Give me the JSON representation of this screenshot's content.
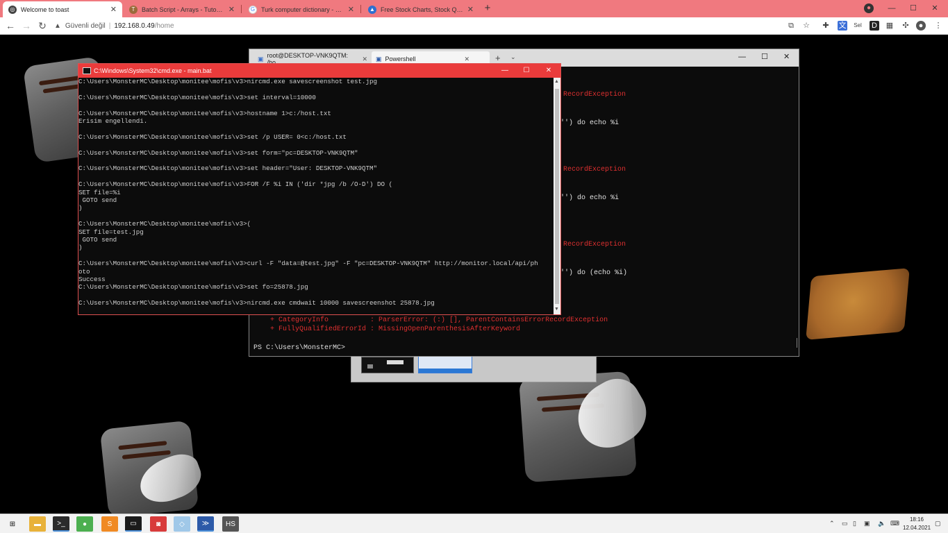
{
  "browser": {
    "tabs": [
      {
        "title": "Welcome to toast",
        "favicon": "globe-icon",
        "color": "#444444"
      },
      {
        "title": "Batch Script - Arrays - Tutorialsp",
        "favicon": "tutorialspoint-icon",
        "color": "#9a6a3a"
      },
      {
        "title": "Turk computer dictionary - Goo",
        "favicon": "google-icon",
        "color": "#4285f4"
      },
      {
        "title": "Free Stock Charts, Stock Quotes",
        "favicon": "chart-icon",
        "color": "#2f6fd0"
      }
    ],
    "new_tab": "+",
    "window_controls": {
      "minimize": "—",
      "maximize": "☐",
      "close": "✕"
    },
    "address": {
      "warning": "Güvenli değil",
      "host": "192.168.0.49",
      "path": "/home"
    }
  },
  "powershell": {
    "tabs": [
      {
        "title": "root@DESKTOP-VNK9QTM: /ho"
      },
      {
        "title": "Powershell"
      }
    ],
    "lines_right": [
      {
        "text": "RecordException",
        "color": "red"
      },
      {
        "text": "'') do echo %i",
        "color": "white"
      },
      {
        "text": "RecordException",
        "color": "red"
      },
      {
        "text": "'') do echo %i",
        "color": "white"
      },
      {
        "text": "RecordException",
        "color": "red"
      },
      {
        "text": "'') do (echo %i)",
        "color": "white"
      }
    ],
    "error_lines": [
      "    + CategoryInfo          : ParserError: (:) [], ParentContainsErrorRecordException",
      "    + FullyQualifiedErrorId : MissingOpenParenthesisAfterKeyword"
    ],
    "prompt": "PS C:\\Users\\MonsterMC>"
  },
  "cmd": {
    "title": "C:\\Windows\\System32\\cmd.exe - main.bat",
    "lines": [
      "C:\\Users\\MonsterMC\\Desktop\\monitee\\mofis\\v3>nircmd.exe savescreenshot test.jpg",
      "",
      "C:\\Users\\MonsterMC\\Desktop\\monitee\\mofis\\v3>set interval=10000",
      "",
      "C:\\Users\\MonsterMC\\Desktop\\monitee\\mofis\\v3>hostname 1>c:/host.txt",
      "Erisim engellendi.",
      "",
      "C:\\Users\\MonsterMC\\Desktop\\monitee\\mofis\\v3>set /p USER= 0<c:/host.txt",
      "",
      "C:\\Users\\MonsterMC\\Desktop\\monitee\\mofis\\v3>set form=\"pc=DESKTOP-VNK9QTM\"",
      "",
      "C:\\Users\\MonsterMC\\Desktop\\monitee\\mofis\\v3>set header=\"User: DESKTOP-VNK9QTM\"",
      "",
      "C:\\Users\\MonsterMC\\Desktop\\monitee\\mofis\\v3>FOR /F %i IN ('dir *jpg /b /O-D') DO (",
      "SET file=%i",
      " GOTO send",
      ")",
      "",
      "C:\\Users\\MonsterMC\\Desktop\\monitee\\mofis\\v3>(",
      "SET file=test.jpg",
      " GOTO send",
      ")",
      "",
      "C:\\Users\\MonsterMC\\Desktop\\monitee\\mofis\\v3>curl -F \"data=@test.jpg\" -F \"pc=DESKTOP-VNK9QTM\" http://monitor.local/api/ph",
      "oto",
      "Success",
      "C:\\Users\\MonsterMC\\Desktop\\monitee\\mofis\\v3>set fo=25878.jpg",
      "",
      "C:\\Users\\MonsterMC\\Desktop\\monitee\\mofis\\v3>nircmd.exe cmdwait 10000 savescreenshot 25878.jpg",
      "",
      "_"
    ],
    "controls": {
      "minimize": "—",
      "maximize": "☐",
      "close": "✕"
    }
  },
  "taskbar": {
    "apps": [
      {
        "name": "start-button",
        "glyph": "⊞",
        "color": "#2b2b2b"
      },
      {
        "name": "file-explorer",
        "glyph": "▬",
        "color": "#e8b23a"
      },
      {
        "name": "terminal",
        "glyph": ">_",
        "color": "#2b2b2b"
      },
      {
        "name": "chrome",
        "glyph": "●",
        "color": "#4caf50"
      },
      {
        "name": "sublime-text",
        "glyph": "S",
        "color": "#f08a24"
      },
      {
        "name": "command-prompt",
        "glyph": "▭",
        "color": "#1b1b1b"
      },
      {
        "name": "screenshot-tool",
        "glyph": "◙",
        "color": "#d83b3b"
      },
      {
        "name": "paint-tool",
        "glyph": "◇",
        "color": "#a0c8e8"
      },
      {
        "name": "powershell",
        "glyph": "≫",
        "color": "#2d5aa8"
      },
      {
        "name": "hs-app",
        "glyph": "HS",
        "color": "#555555"
      }
    ],
    "time": "18:16",
    "date": "12.04.2021"
  }
}
